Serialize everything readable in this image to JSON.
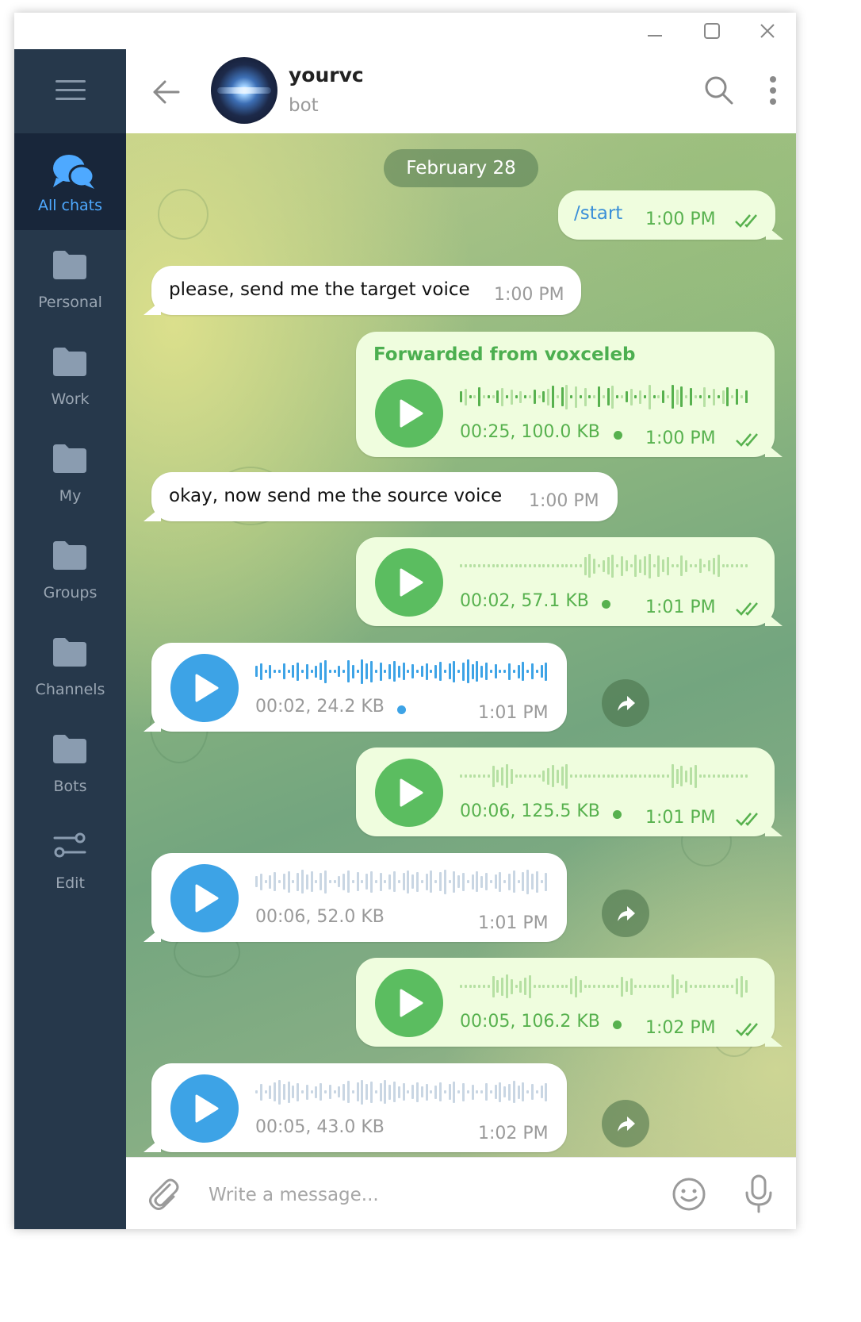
{
  "window": {
    "minimize_icon": "minimize-icon",
    "maximize_icon": "maximize-icon",
    "close_icon": "close-icon"
  },
  "sidebar": {
    "menu_icon": "hamburger-icon",
    "folders": [
      {
        "label": "All chats",
        "icon": "chat-bubbles-icon",
        "active": true
      },
      {
        "label": "Personal",
        "icon": "folder-icon"
      },
      {
        "label": "Work",
        "icon": "folder-icon"
      },
      {
        "label": "My",
        "icon": "folder-icon"
      },
      {
        "label": "Groups",
        "icon": "folder-icon"
      },
      {
        "label": "Channels",
        "icon": "folder-icon"
      },
      {
        "label": "Bots",
        "icon": "folder-icon"
      },
      {
        "label": "Edit",
        "icon": "sliders-icon"
      }
    ]
  },
  "header": {
    "title": "yourvc",
    "subtitle": "bot"
  },
  "chat": {
    "date": "February 28",
    "messages": [
      {
        "dir": "out",
        "type": "text",
        "text": "/start",
        "time": "1:00 PM"
      },
      {
        "dir": "in",
        "type": "text",
        "text": "please, send me the target voice",
        "time": "1:00 PM"
      },
      {
        "dir": "out",
        "type": "voice",
        "forwarded": "Forwarded from voxceleb",
        "info": "00:25, 100.0 KB",
        "time": "1:00 PM"
      },
      {
        "dir": "in",
        "type": "text",
        "text": "okay, now send me the source voice",
        "time": "1:00 PM"
      },
      {
        "dir": "out",
        "type": "voice",
        "info": "00:02, 57.1 KB",
        "time": "1:01 PM"
      },
      {
        "dir": "in",
        "type": "voice",
        "info": "00:02, 24.2 KB",
        "time": "1:01 PM"
      },
      {
        "dir": "out",
        "type": "voice",
        "info": "00:06, 125.5 KB",
        "time": "1:01 PM"
      },
      {
        "dir": "in",
        "type": "voice",
        "info": "00:06, 52.0 KB",
        "time": "1:01 PM"
      },
      {
        "dir": "out",
        "type": "voice",
        "info": "00:05, 106.2 KB",
        "time": "1:02 PM"
      },
      {
        "dir": "in",
        "type": "voice",
        "info": "00:05, 43.0 KB",
        "time": "1:02 PM"
      }
    ]
  },
  "composer": {
    "placeholder": "Write a message..."
  },
  "colors": {
    "sidebar": "#26384b",
    "accent": "#4ea9ff",
    "out_bubble": "#effdde",
    "green": "#5bbd60",
    "blue": "#3da3e6"
  }
}
